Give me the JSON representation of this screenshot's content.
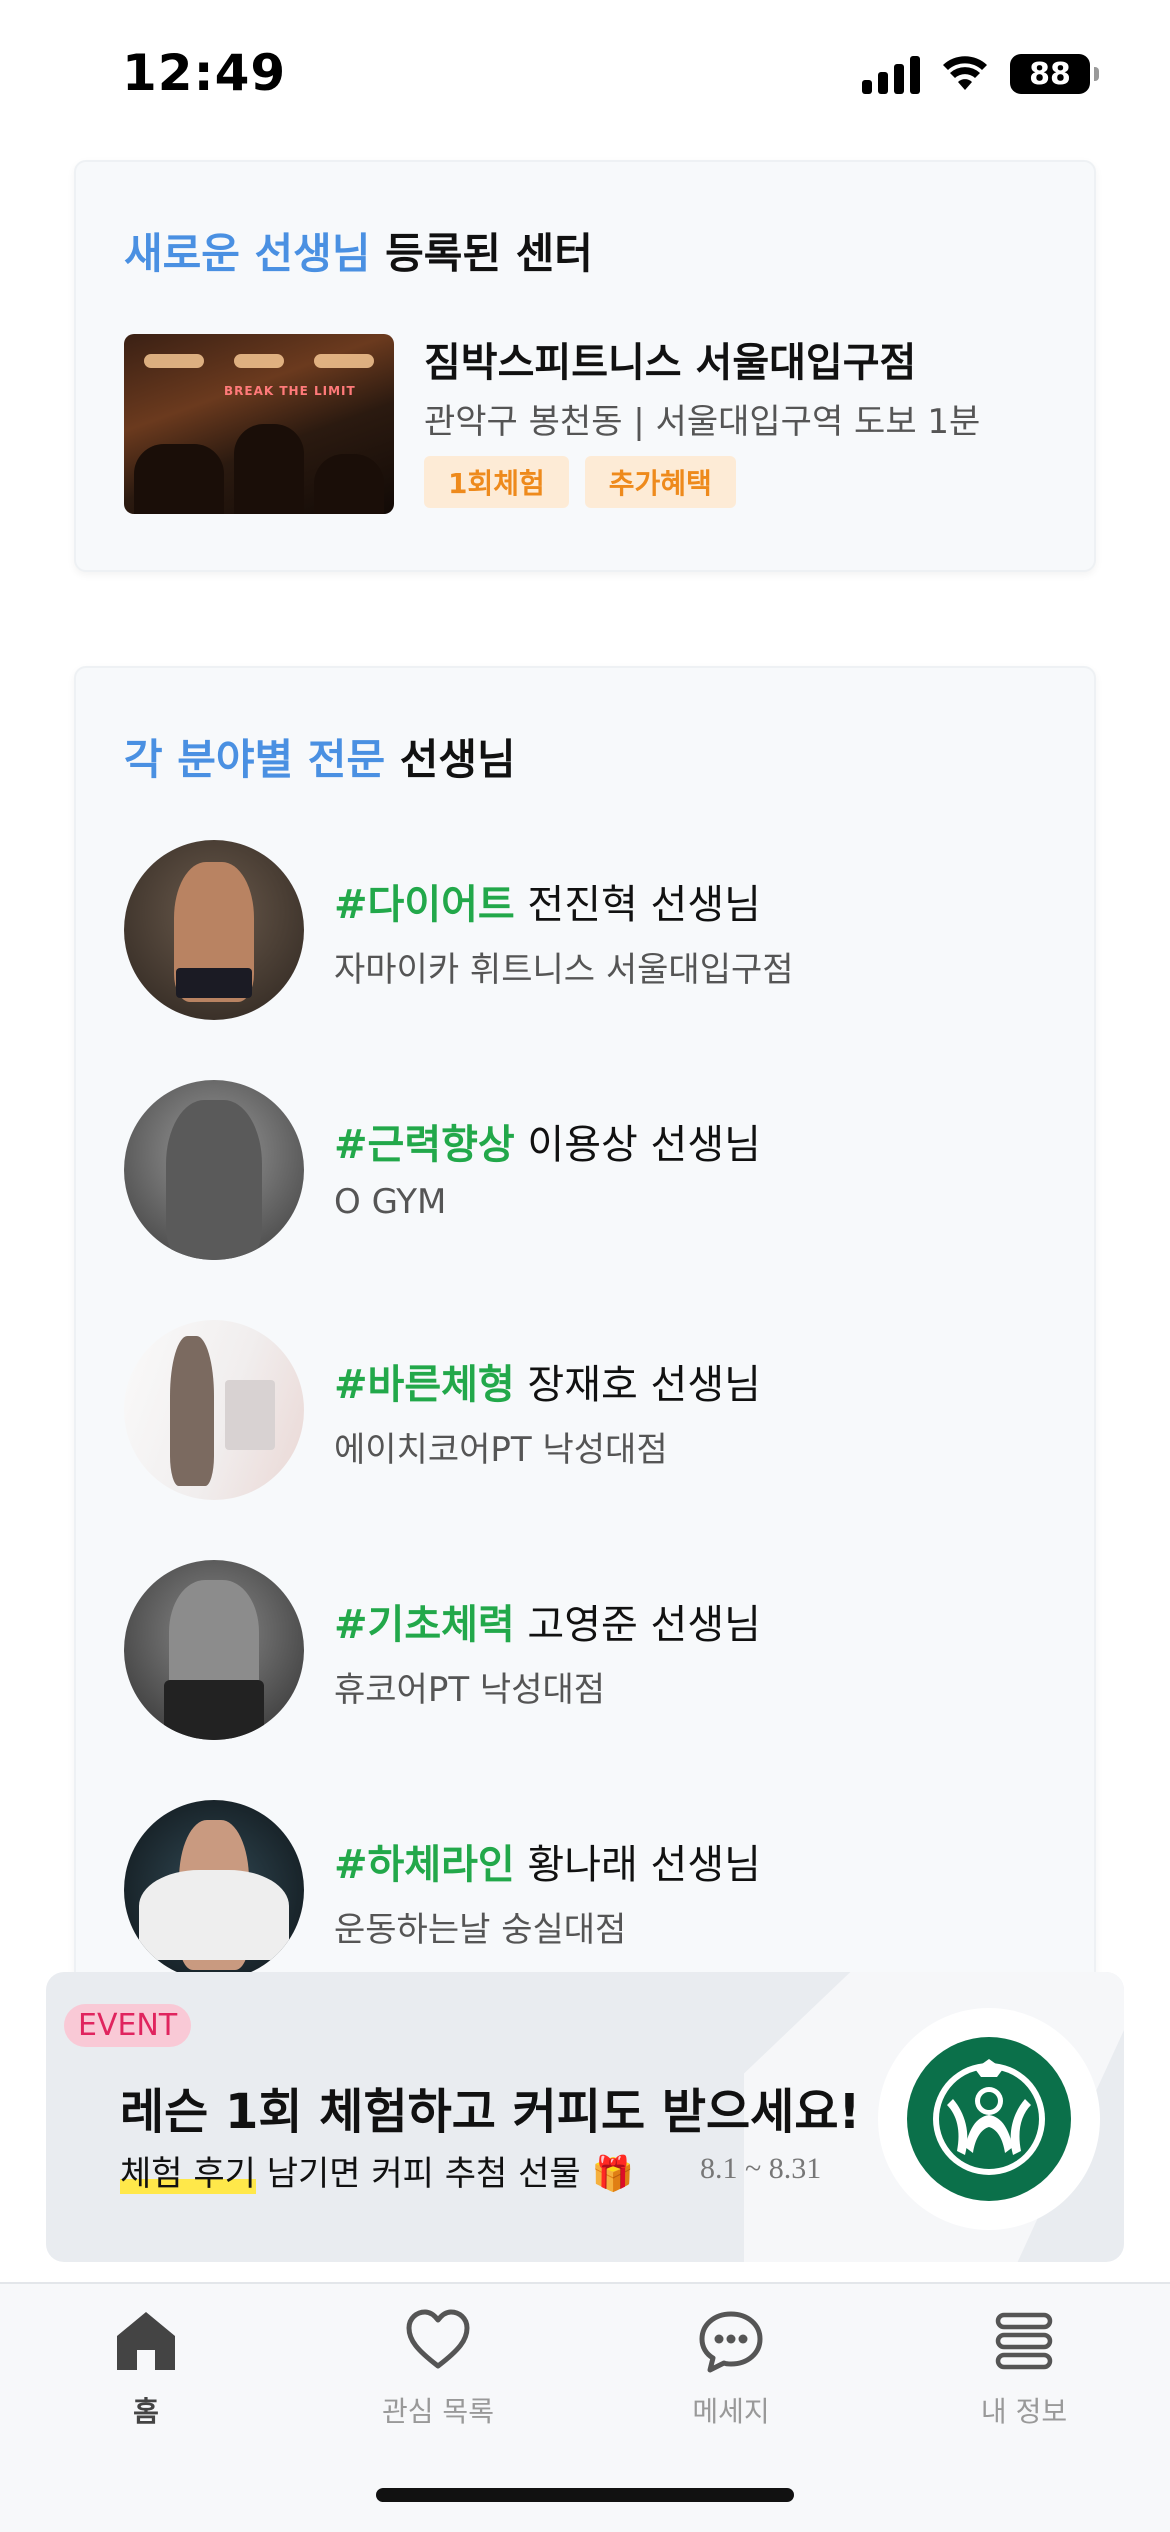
{
  "status_bar": {
    "time": "12:49",
    "battery": "88"
  },
  "new_center": {
    "title_highlight": "새로운 선생님",
    "title_rest": " 등록된 센터",
    "center_name": "짐박스피트니스 서울대입구점",
    "location": "관악구 봉천동 | 서울대입구역 도보 1분",
    "tags": [
      "1회체험",
      "추가혜택"
    ],
    "thumb_sign": "BREAK THE LIMIT"
  },
  "experts": {
    "title_highlight": "각 분야별 전문",
    "title_rest": " 선생님",
    "trainers": [
      {
        "tag": "#다이어트",
        "name": " 전진혁 선생님",
        "gym": "자마이카 휘트니스 서울대입구점"
      },
      {
        "tag": "#근력향상",
        "name": " 이용상 선생님",
        "gym": "O GYM"
      },
      {
        "tag": "#바른체형",
        "name": " 장재호 선생님",
        "gym": "에이치코어PT 낙성대점"
      },
      {
        "tag": "#기초체력",
        "name": " 고영준 선생님",
        "gym": "휴코어PT 낙성대점"
      },
      {
        "tag": "#하체라인",
        "name": " 황나래 선생님",
        "gym": "운동하는날 숭실대점"
      }
    ]
  },
  "event": {
    "badge": "EVENT",
    "title": "레슨 1회 체험하고 커피도 받으세요!",
    "sub_highlight": "체험 후기",
    "sub_rest": " 남기면 커피 추첨 선물",
    "gift_icon": "🎁",
    "date": "8.1 ~ 8.31"
  },
  "tabbar": {
    "tabs": [
      {
        "label": "홈",
        "icon": "home-icon"
      },
      {
        "label": "관심 목록",
        "icon": "heart-icon"
      },
      {
        "label": "메세지",
        "icon": "chat-bubble-icon"
      },
      {
        "label": "내 정보",
        "icon": "menu-icon"
      }
    ]
  },
  "colors": {
    "accent_blue": "#4a90e2",
    "hashtag_green": "#22a84a",
    "tag_orange": "#ee8a1c",
    "starbucks_green": "#0b704a"
  }
}
